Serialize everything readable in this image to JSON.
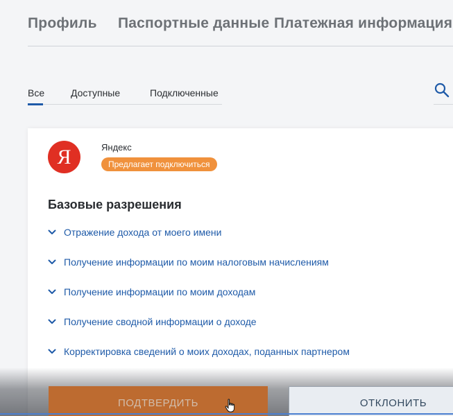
{
  "top_tabs": {
    "profile": "Профиль",
    "passport": "Паспортные данные",
    "payment": "Платежная информация"
  },
  "filter_tabs": {
    "all": "Все",
    "available": "Доступные",
    "connected": "Подключенные",
    "active": "all"
  },
  "partner": {
    "logo_letter": "Я",
    "name": "Яндекс",
    "status_badge": "Предлагает подключиться"
  },
  "permissions": {
    "title": "Базовые разрешения",
    "items": [
      "Отражение дохода от моего имени",
      "Получение информации по моим налоговым начислениям",
      "Получение информации по моим доходам",
      "Получение сводной информации о доходе",
      "Корректировка сведений о моих доходах, поданных партнером"
    ]
  },
  "actions": {
    "confirm": "ПОДТВЕРДИТЬ",
    "reject": "ОТКЛОНИТЬ"
  },
  "colors": {
    "accent_blue": "#1e5aa8",
    "badge_orange": "#f0913c",
    "confirm_orange": "#e7823a",
    "logo_red": "#e02f23"
  },
  "icons": {
    "search": "search-icon",
    "chevron": "chevron-down-icon",
    "cursor": "hand-cursor-icon"
  }
}
